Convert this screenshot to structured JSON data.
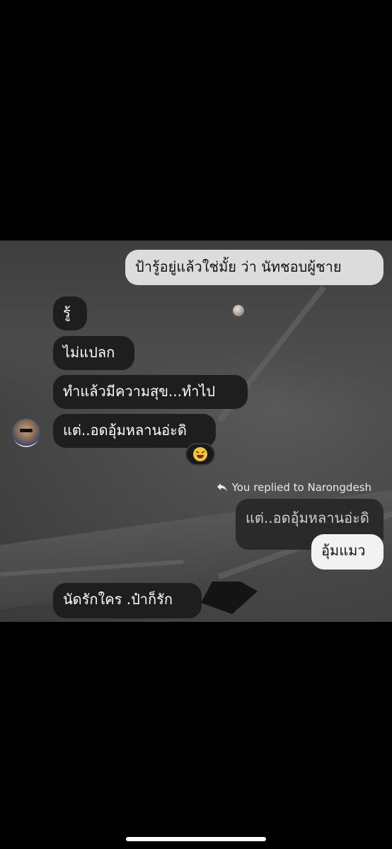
{
  "chat": {
    "messages": [
      {
        "id": "m1",
        "side": "out",
        "text": "ป้ารู้อยู่แล้วใช่มั้ย ว่า นัทชอบผู้ชาย"
      },
      {
        "id": "m2",
        "side": "in",
        "text": "รู้"
      },
      {
        "id": "m3",
        "side": "in",
        "text": "ไม่แปลก"
      },
      {
        "id": "m4",
        "side": "in",
        "text": "ทำแล้วมีความสุข...ทำไป"
      },
      {
        "id": "m5",
        "side": "in",
        "text": "แต่..อดอุ้มหลานอ่ะดิ"
      },
      {
        "id": "m6",
        "side": "out",
        "text": "แต่..อดอุ้มหลานอ่ะดิ",
        "quoted": true
      },
      {
        "id": "m7",
        "side": "out",
        "text": "อุ้มแมว"
      },
      {
        "id": "m8",
        "side": "in",
        "text": "นัดรักใคร .ป๋าก็รัก"
      }
    ],
    "reply_label": "You replied to Narongdesh",
    "reaction": "laughing-face"
  },
  "colors": {
    "incoming_bubble": "#1e1e1e",
    "outgoing_bubble": "#dcdcdc",
    "outgoing_latest": "#f2f2f2",
    "quoted_bubble": "#2a2a2a"
  }
}
